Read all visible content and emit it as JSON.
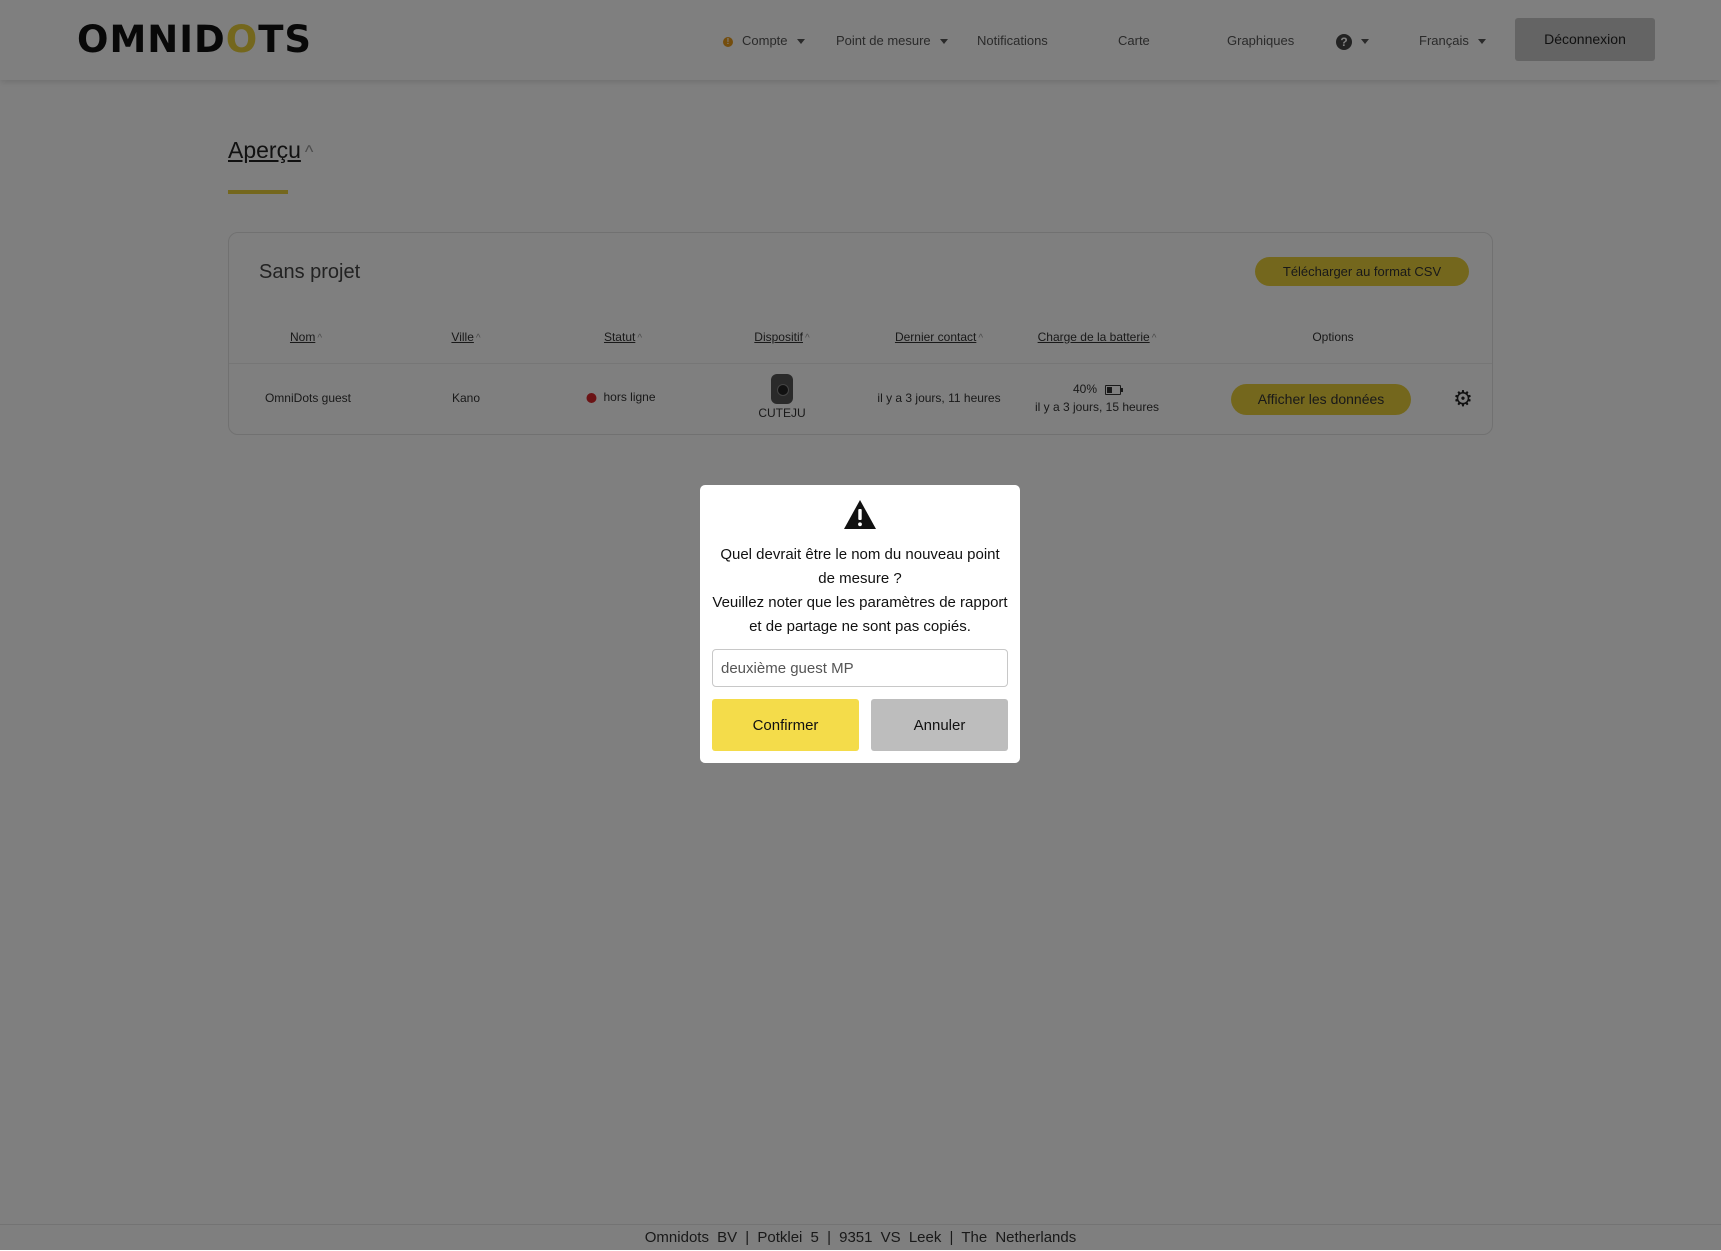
{
  "header": {
    "logo_pre": "OMNID",
    "logo_accent": "O",
    "logo_post": "TS",
    "nav": {
      "account": "Compte",
      "measure_point": "Point de mesure",
      "notifications": "Notifications",
      "map": "Carte",
      "charts": "Graphiques",
      "language": "Français"
    },
    "logout_label": "Déconnexion",
    "accent_color": "#e8cf3a"
  },
  "page": {
    "title": "Aperçu",
    "sort_indicator": "^"
  },
  "card": {
    "title": "Sans projet",
    "csv_button": "Télécharger au format CSV",
    "columns": {
      "name": "Nom",
      "city": "Ville",
      "status": "Statut",
      "device": "Dispositif",
      "last_contact": "Dernier contact",
      "battery": "Charge de la batterie",
      "options": "Options"
    },
    "rows": [
      {
        "name": "OmniDots guest",
        "city": "Kano",
        "status": "hors ligne",
        "device": "CUTEJU",
        "last_contact": "il y a 3 jours, 11 heures",
        "battery_level": "40%",
        "battery_time": "il y a 3 jours, 15 heures",
        "view_button": "Afficher les données"
      }
    ]
  },
  "footer": {
    "text": "Omnidots BV | Potklei 5 | 9351 VS Leek | The Netherlands"
  },
  "modal": {
    "icon": "warning-icon",
    "line1": "Quel devrait être le nom du nouveau point de mesure ?",
    "line2": "Veuillez noter que les paramètres de rapport et de partage ne sont pas copiés.",
    "input_value": "deuxième guest MP",
    "confirm_label": "Confirmer",
    "cancel_label": "Annuler"
  }
}
